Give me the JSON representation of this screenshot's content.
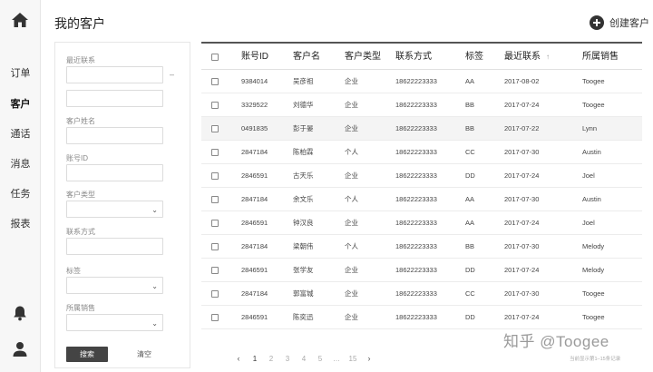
{
  "nav": {
    "items": [
      {
        "label": "订单"
      },
      {
        "label": "客户"
      },
      {
        "label": "通话"
      },
      {
        "label": "消息"
      },
      {
        "label": "任务"
      },
      {
        "label": "报表"
      }
    ],
    "active": "客户",
    "icons": [
      "home-icon",
      "bell-icon",
      "user-icon"
    ]
  },
  "header": {
    "title": "我的客户",
    "create_label": "创建客户"
  },
  "filters": {
    "recent_contact_label": "最近联系",
    "range_separator": "–",
    "customer_name_label": "客户姓名",
    "account_id_label": "账号ID",
    "customer_type_label": "客户类型",
    "contact_label": "联系方式",
    "tag_label": "标签",
    "sales_label": "所属销售",
    "search_label": "搜索",
    "clear_label": "清空"
  },
  "table": {
    "headers": {
      "id": "账号ID",
      "name": "客户名",
      "type": "客户类型",
      "phone": "联系方式",
      "tag": "标签",
      "date": "最近联系",
      "sales": "所属销售"
    },
    "sort_indicator": "↑",
    "highlighted_row": 2,
    "rows": [
      {
        "id": "9384014",
        "name": "吴彦祖",
        "type": "企业",
        "phone": "18622223333",
        "tag": "AA",
        "date": "2017-08-02",
        "sales": "Toogee"
      },
      {
        "id": "3329522",
        "name": "刘德华",
        "type": "企业",
        "phone": "18622223333",
        "tag": "BB",
        "date": "2017-07-24",
        "sales": "Toogee"
      },
      {
        "id": "0491835",
        "name": "彭于晏",
        "type": "企业",
        "phone": "18622223333",
        "tag": "BB",
        "date": "2017-07-22",
        "sales": "Lynn"
      },
      {
        "id": "2847184",
        "name": "陈柏霖",
        "type": "个人",
        "phone": "18622223333",
        "tag": "CC",
        "date": "2017-07-30",
        "sales": "Austin"
      },
      {
        "id": "2846591",
        "name": "古天乐",
        "type": "企业",
        "phone": "18622223333",
        "tag": "DD",
        "date": "2017-07-24",
        "sales": "Joel"
      },
      {
        "id": "2847184",
        "name": "余文乐",
        "type": "个人",
        "phone": "18622223333",
        "tag": "AA",
        "date": "2017-07-30",
        "sales": "Austin"
      },
      {
        "id": "2846591",
        "name": "钟汉良",
        "type": "企业",
        "phone": "18622223333",
        "tag": "AA",
        "date": "2017-07-24",
        "sales": "Joel"
      },
      {
        "id": "2847184",
        "name": "梁朝伟",
        "type": "个人",
        "phone": "18622223333",
        "tag": "BB",
        "date": "2017-07-30",
        "sales": "Melody"
      },
      {
        "id": "2846591",
        "name": "张学友",
        "type": "企业",
        "phone": "18622223333",
        "tag": "DD",
        "date": "2017-07-24",
        "sales": "Melody"
      },
      {
        "id": "2847184",
        "name": "郭富城",
        "type": "企业",
        "phone": "18622223333",
        "tag": "CC",
        "date": "2017-07-30",
        "sales": "Toogee"
      },
      {
        "id": "2846591",
        "name": "陈奕迅",
        "type": "企业",
        "phone": "18622223333",
        "tag": "DD",
        "date": "2017-07-24",
        "sales": "Toogee"
      }
    ]
  },
  "pagination": {
    "prev": "‹",
    "pages": [
      "1",
      "2",
      "3",
      "4",
      "5",
      "…",
      "15"
    ],
    "current": "1",
    "next": "›",
    "summary": "当前显示第1–15条记录"
  },
  "watermark": "知乎 @Toogee",
  "colors": {
    "accent": "#444444",
    "row_highlight": "#f4f4f4",
    "nav_background": "#f7f7f7"
  }
}
